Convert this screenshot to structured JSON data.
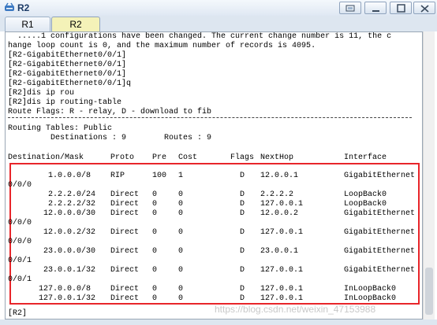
{
  "window": {
    "title": "R2",
    "icon": "router-app-icon",
    "controls": [
      "restore-icon",
      "minimize-icon",
      "maximize-icon",
      "close-icon"
    ]
  },
  "tabs": [
    {
      "label": "R1",
      "active": false
    },
    {
      "label": "R2",
      "active": true
    }
  ],
  "console": {
    "intro_lines": [
      "  .....1 configurations have been changed. The current change number is 11, the c",
      "hange loop count is 0, and the maximum number of records is 4095.",
      "[R2-GigabitEthernet0/0/1]",
      "[R2-GigabitEthernet0/0/1]",
      "[R2-GigabitEthernet0/0/1]",
      "[R2-GigabitEthernet0/0/1]q",
      "[R2]dis ip rou",
      "[R2]dis ip routing-table",
      "Route Flags: R - relay, D - download to fib"
    ],
    "routing_tables": "Routing Tables: Public",
    "summary": "         Destinations : 9        Routes : 9",
    "headers": [
      "Destination/Mask",
      "Proto",
      "Pre",
      "Cost",
      "Flags",
      "NextHop",
      "Interface"
    ],
    "routes": [
      {
        "dest": "1.0.0.0/8",
        "proto": "RIP",
        "pre": "100",
        "cost": "1",
        "flags": "D",
        "nexthop": "12.0.0.1",
        "iface": "GigabitEthernet",
        "cont": "0/0/0"
      },
      {
        "dest": "2.2.2.0/24",
        "proto": "Direct",
        "pre": "0",
        "cost": "0",
        "flags": "D",
        "nexthop": "2.2.2.2",
        "iface": "LoopBack0",
        "cont": ""
      },
      {
        "dest": "2.2.2.2/32",
        "proto": "Direct",
        "pre": "0",
        "cost": "0",
        "flags": "D",
        "nexthop": "127.0.0.1",
        "iface": "LoopBack0",
        "cont": ""
      },
      {
        "dest": "12.0.0.0/30",
        "proto": "Direct",
        "pre": "0",
        "cost": "0",
        "flags": "D",
        "nexthop": "12.0.0.2",
        "iface": "GigabitEthernet",
        "cont": "0/0/0"
      },
      {
        "dest": "12.0.0.2/32",
        "proto": "Direct",
        "pre": "0",
        "cost": "0",
        "flags": "D",
        "nexthop": "127.0.0.1",
        "iface": "GigabitEthernet",
        "cont": "0/0/0"
      },
      {
        "dest": "23.0.0.0/30",
        "proto": "Direct",
        "pre": "0",
        "cost": "0",
        "flags": "D",
        "nexthop": "23.0.0.1",
        "iface": "GigabitEthernet",
        "cont": "0/0/1"
      },
      {
        "dest": "23.0.0.1/32",
        "proto": "Direct",
        "pre": "0",
        "cost": "0",
        "flags": "D",
        "nexthop": "127.0.0.1",
        "iface": "GigabitEthernet",
        "cont": "0/0/1"
      },
      {
        "dest": "127.0.0.0/8",
        "proto": "Direct",
        "pre": "0",
        "cost": "0",
        "flags": "D",
        "nexthop": "127.0.0.1",
        "iface": "InLoopBack0",
        "cont": ""
      },
      {
        "dest": "127.0.0.1/32",
        "proto": "Direct",
        "pre": "0",
        "cost": "0",
        "flags": "D",
        "nexthop": "127.0.0.1",
        "iface": "InLoopBack0",
        "cont": ""
      }
    ],
    "prompt": "[R2]"
  },
  "watermark": "https://blog.csdn.net/weixin_47153988",
  "colors": {
    "highlight_box": "#e8252a",
    "active_tab": "#f4f2b8"
  }
}
